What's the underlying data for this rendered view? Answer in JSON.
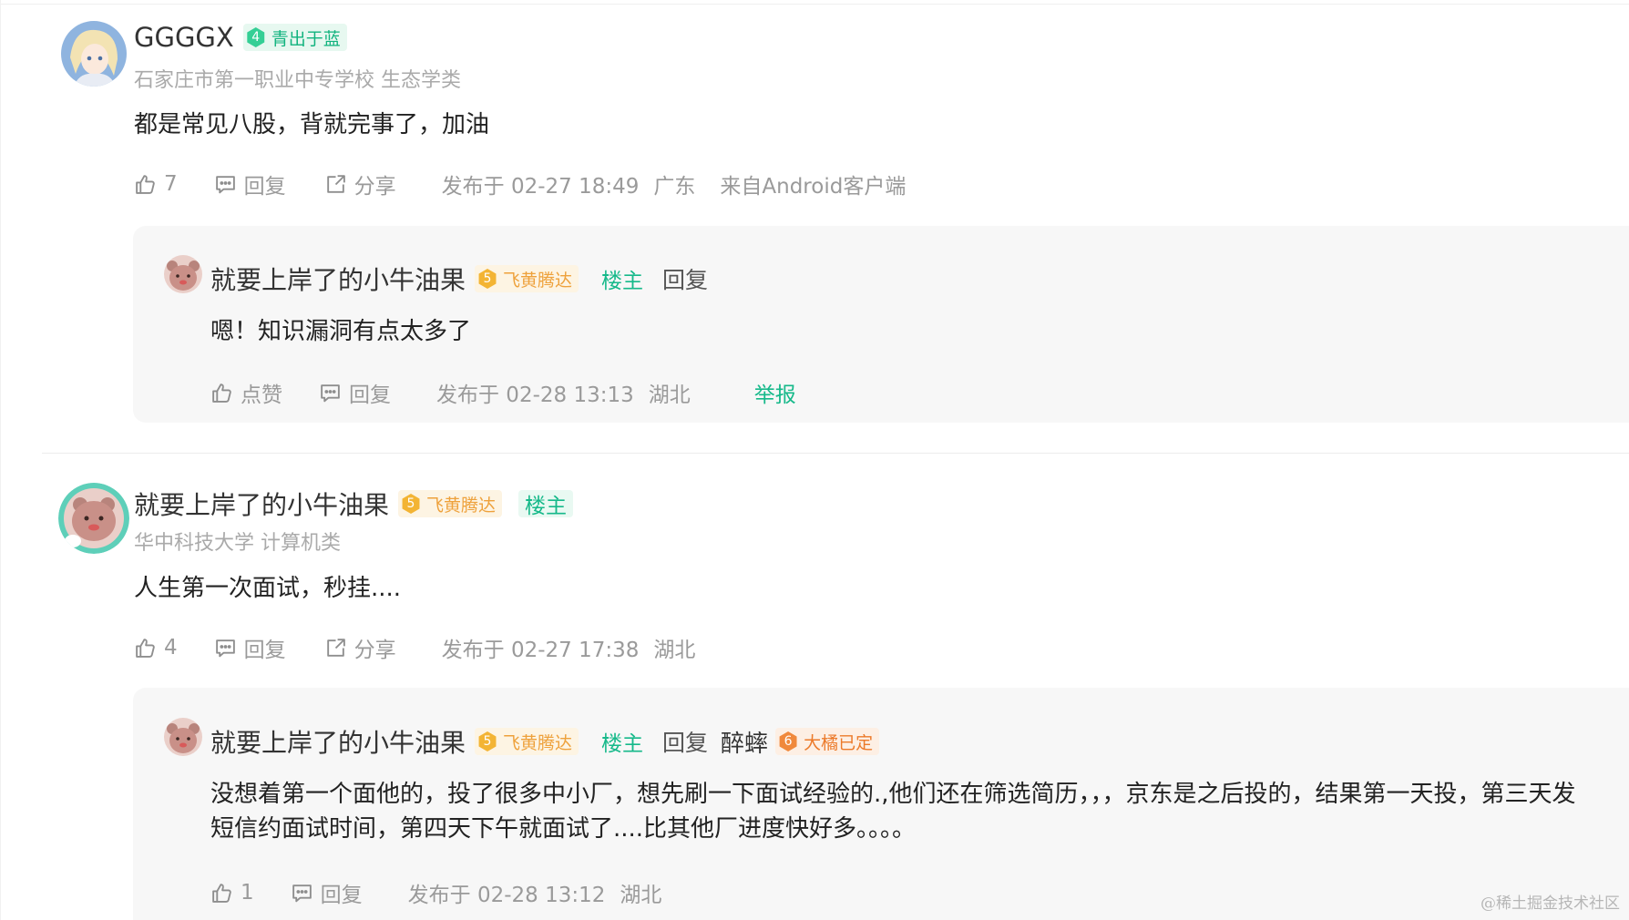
{
  "colors": {
    "accent": "#16b98a",
    "muted": "#9a9a9a",
    "card_bg": "#f7f7f7"
  },
  "comments": [
    {
      "author": "GGGGX",
      "badge": {
        "level": "4",
        "title": "青出于蓝"
      },
      "school": "石家庄市第一职业中专学校 生态学类",
      "content": "都是常见八股，背就完事了，加油",
      "likes": "7",
      "reply_label": "回复",
      "share_label": "分享",
      "posted": "发布于 02-27 18:49",
      "region": "广东",
      "client": "来自Android客户端",
      "sub_reply": {
        "author": "就要上岸了的小牛油果",
        "badge": {
          "level": "5",
          "title": "飞黄腾达"
        },
        "owner_tag": "楼主",
        "reply_keyword": "回复",
        "content": "嗯！知识漏洞有点太多了",
        "like_label": "点赞",
        "reply_label": "回复",
        "posted": "发布于 02-28 13:13",
        "region": "湖北",
        "report_label": "举报"
      }
    },
    {
      "author": "就要上岸了的小牛油果",
      "badge": {
        "level": "5",
        "title": "飞黄腾达"
      },
      "owner_tag": "楼主",
      "school": "华中科技大学 计算机类",
      "content": "人生第一次面试，秒挂....",
      "likes": "4",
      "reply_label": "回复",
      "share_label": "分享",
      "posted": "发布于 02-27 17:38",
      "region": "湖北",
      "sub_reply": {
        "author": "就要上岸了的小牛油果",
        "badge": {
          "level": "5",
          "title": "飞黄腾达"
        },
        "owner_tag": "楼主",
        "reply_keyword": "回复",
        "reply_to": "醉蟀",
        "reply_to_badge": {
          "level": "6",
          "title": "大橘已定"
        },
        "content": "没想着第一个面他的，投了很多中小厂，想先刷一下面试经验的.,他们还在筛选简历，，，京东是之后投的，结果第一天投，第三天发短信约面试时间，第四天下午就面试了....比其他厂进度快好多。。。。",
        "likes": "1",
        "reply_label": "回复",
        "posted": "发布于 02-28 13:12",
        "region": "湖北"
      }
    }
  ],
  "watermark": "@稀土掘金技术社区"
}
